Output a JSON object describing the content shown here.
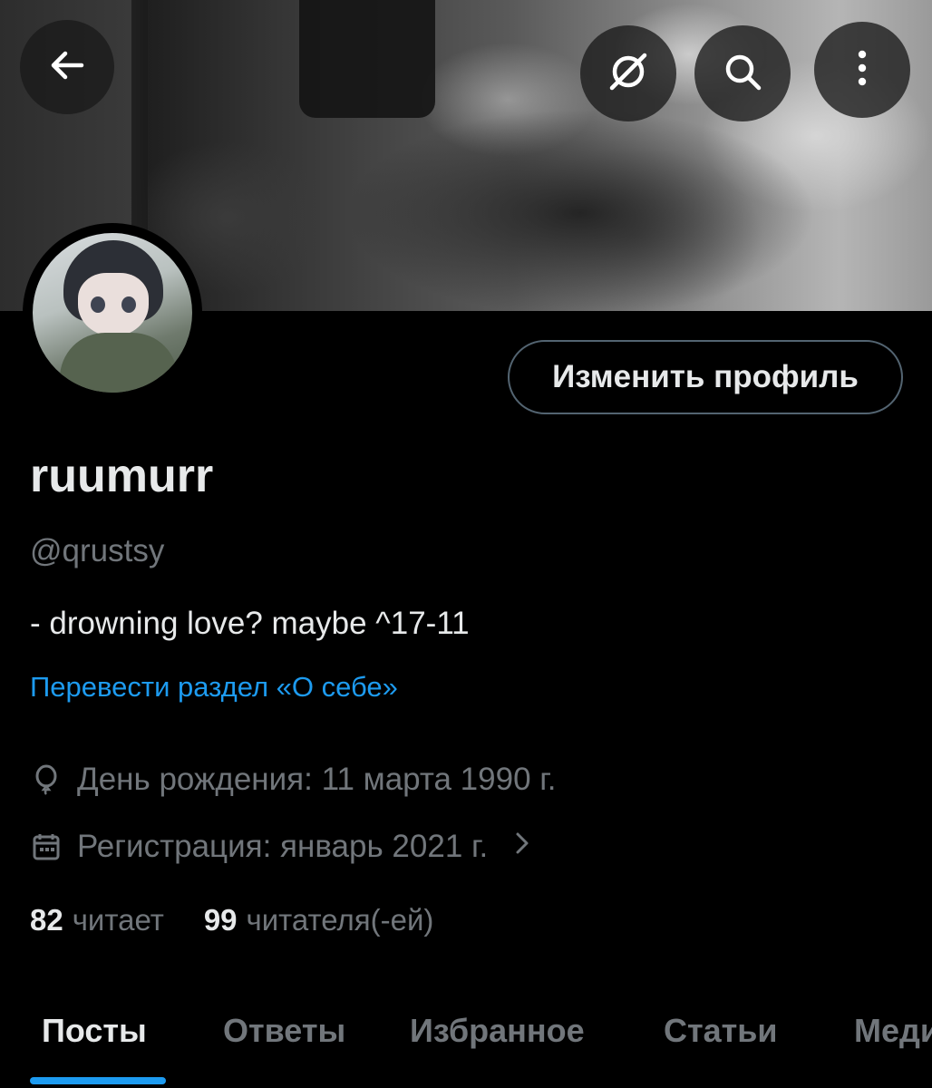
{
  "profile": {
    "display_name": "ruumurr",
    "handle": "@qrustsy",
    "bio": "- drowning love? maybe ^17-11",
    "translate_link": "Перевести раздел «О себе»",
    "birthday": "День рождения: 11 марта 1990 г.",
    "joined": "Регистрация: январь 2021 г.",
    "following_count": "82",
    "following_label": "читает",
    "followers_count": "99",
    "followers_label": "читателя(-ей)",
    "edit_button": "Изменить профиль"
  },
  "header_icons": {
    "back": "arrow-left-icon",
    "grok": "grok-icon",
    "search": "search-icon",
    "more": "more-vertical-icon"
  },
  "tabs": [
    {
      "label": "Посты",
      "active": true
    },
    {
      "label": "Ответы",
      "active": false
    },
    {
      "label": "Избранное",
      "active": false
    },
    {
      "label": "Статьи",
      "active": false
    },
    {
      "label": "Медиа",
      "active": false
    }
  ],
  "colors": {
    "accent": "#1d9bf0",
    "background": "#000000",
    "text_primary": "#e7e9ea",
    "text_secondary": "#71767b",
    "border": "#536471"
  }
}
